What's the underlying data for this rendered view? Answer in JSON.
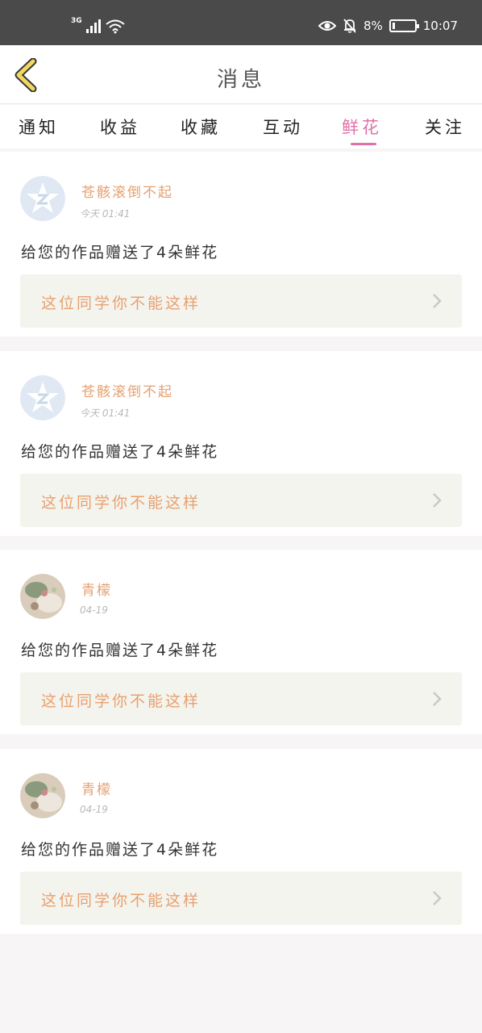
{
  "status_bar": {
    "network": "3G",
    "battery": "8%",
    "time": "10:07",
    "icons": [
      "signal-icon",
      "wifi-icon",
      "eye-icon",
      "bell-off-icon",
      "battery-icon"
    ]
  },
  "header": {
    "title": "消息",
    "back_icon": "chevron-left-icon"
  },
  "tabs": [
    {
      "label": "通知",
      "active": false
    },
    {
      "label": "收益",
      "active": false
    },
    {
      "label": "收藏",
      "active": false
    },
    {
      "label": "互动",
      "active": false
    },
    {
      "label": "鲜花",
      "active": true
    },
    {
      "label": "关注",
      "active": false
    }
  ],
  "messages": [
    {
      "username": "苍骸滚倒不起",
      "time": "今天 01:41",
      "text": "给您的作品赠送了4朵鲜花",
      "quote": "这位同学你不能这样",
      "avatar": "default-avatar"
    },
    {
      "username": "苍骸滚倒不起",
      "time": "今天 01:41",
      "text": "给您的作品赠送了4朵鲜花",
      "quote": "这位同学你不能这样",
      "avatar": "default-avatar"
    },
    {
      "username": "青檬",
      "time": "04-19",
      "text": "给您的作品赠送了4朵鲜花",
      "quote": "这位同学你不能这样",
      "avatar": "photo-avatar"
    },
    {
      "username": "青檬",
      "time": "04-19",
      "text": "给您的作品赠送了4朵鲜花",
      "quote": "这位同学你不能这样",
      "avatar": "photo-avatar"
    }
  ],
  "colors": {
    "accent": "#e070a8",
    "username": "#e5a070",
    "quote_text": "#e8a070",
    "quote_bg": "#f4f4ee",
    "status_bar_bg": "#4a4a4a",
    "back_icon": "#f0d860"
  }
}
